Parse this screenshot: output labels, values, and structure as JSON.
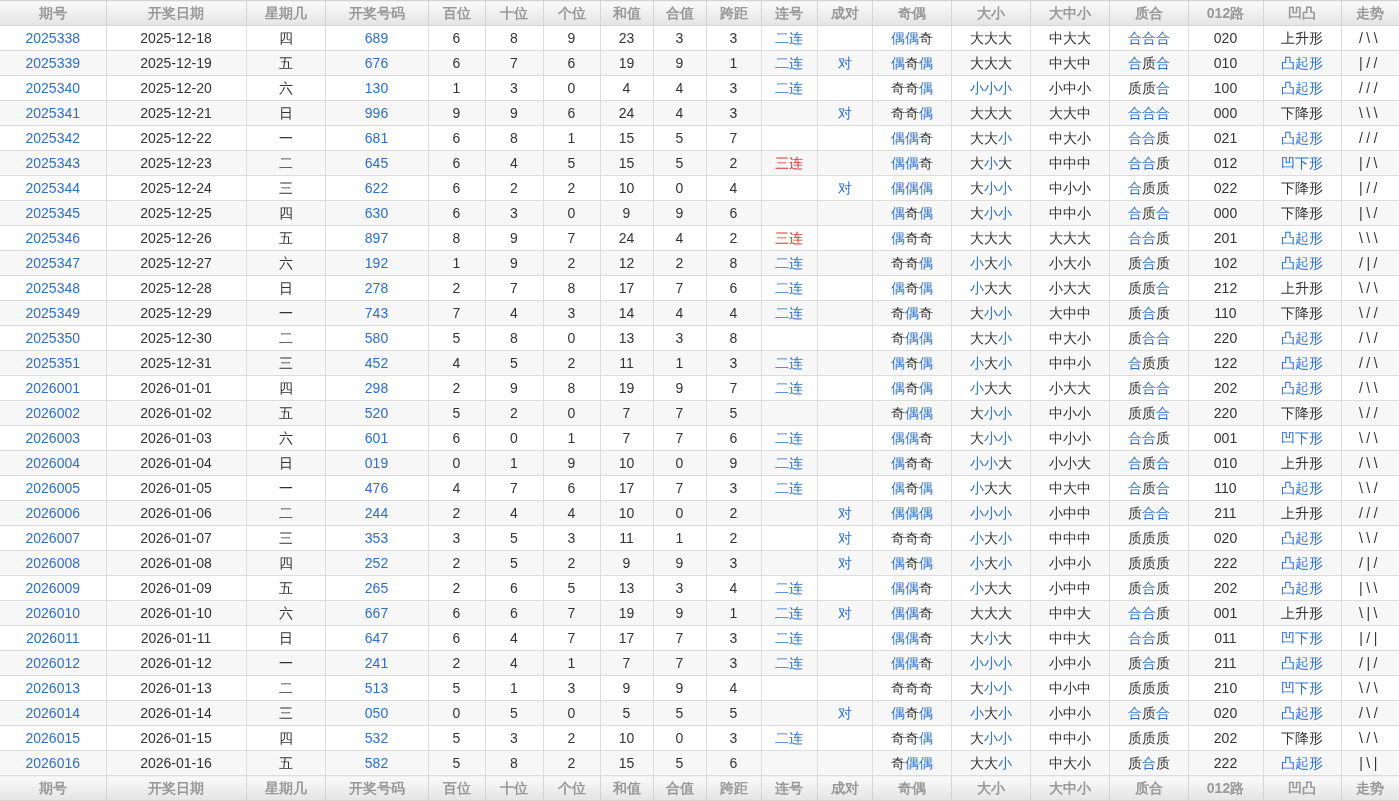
{
  "columns": [
    "期号",
    "开奖日期",
    "星期几",
    "开奖号码",
    "百位",
    "十位",
    "个位",
    "和值",
    "合值",
    "跨距",
    "连号",
    "成对",
    "奇偶",
    "大小",
    "大中小",
    "质合",
    "012路",
    "凹凸",
    "走势"
  ],
  "rows": [
    {
      "issue": "2025338",
      "date": "2025-12-18",
      "weekday": "四",
      "number": "689",
      "digits": [
        "6",
        "8",
        "9"
      ],
      "sum": "23",
      "tail": "3",
      "span": "3",
      "consec": {
        "text": "二连",
        "emphasis": false
      },
      "parity": {
        "text": "偶偶奇",
        "hl": [
          true,
          true,
          false
        ]
      },
      "size": {
        "text": "大大大",
        "hl": [
          false,
          false,
          false
        ]
      },
      "size3": "中大大",
      "prime": {
        "text": "合合合",
        "hl": [
          true,
          true,
          true
        ]
      },
      "route": "020",
      "shape": {
        "text": "上升形",
        "hl": false
      },
      "trend": "/\\\\"
    },
    {
      "issue": "2025339",
      "date": "2025-12-19",
      "weekday": "五",
      "number": "676",
      "digits": [
        "6",
        "7",
        "6"
      ],
      "sum": "19",
      "tail": "9",
      "span": "1",
      "consec": {
        "text": "二连",
        "emphasis": false
      },
      "pair": "对",
      "parity": {
        "text": "偶奇偶",
        "hl": [
          true,
          false,
          true
        ]
      },
      "size": {
        "text": "大大大",
        "hl": [
          false,
          false,
          false
        ]
      },
      "size3": "中大中",
      "prime": {
        "text": "合质合",
        "hl": [
          true,
          false,
          true
        ]
      },
      "route": "010",
      "shape": {
        "text": "凸起形",
        "hl": true
      },
      "trend": "|//"
    },
    {
      "issue": "2025340",
      "date": "2025-12-20",
      "weekday": "六",
      "number": "130",
      "digits": [
        "1",
        "3",
        "0"
      ],
      "sum": "4",
      "tail": "4",
      "span": "3",
      "consec": {
        "text": "二连",
        "emphasis": false
      },
      "parity": {
        "text": "奇奇偶",
        "hl": [
          false,
          false,
          true
        ]
      },
      "size": {
        "text": "小小小",
        "hl": [
          true,
          true,
          true
        ]
      },
      "size3": "小中小",
      "prime": {
        "text": "质质合",
        "hl": [
          false,
          false,
          true
        ]
      },
      "route": "100",
      "shape": {
        "text": "凸起形",
        "hl": true
      },
      "trend": "///"
    },
    {
      "issue": "2025341",
      "date": "2025-12-21",
      "weekday": "日",
      "number": "996",
      "digits": [
        "9",
        "9",
        "6"
      ],
      "sum": "24",
      "tail": "4",
      "span": "3",
      "pair": "对",
      "parity": {
        "text": "奇奇偶",
        "hl": [
          false,
          false,
          true
        ]
      },
      "size": {
        "text": "大大大",
        "hl": [
          false,
          false,
          false
        ]
      },
      "size3": "大大中",
      "prime": {
        "text": "合合合",
        "hl": [
          true,
          true,
          true
        ]
      },
      "route": "000",
      "shape": {
        "text": "下降形",
        "hl": false
      },
      "trend": "\\\\\\"
    },
    {
      "issue": "2025342",
      "date": "2025-12-22",
      "weekday": "一",
      "number": "681",
      "digits": [
        "6",
        "8",
        "1"
      ],
      "sum": "15",
      "tail": "5",
      "span": "7",
      "parity": {
        "text": "偶偶奇",
        "hl": [
          true,
          true,
          false
        ]
      },
      "size": {
        "text": "大大小",
        "hl": [
          false,
          false,
          true
        ]
      },
      "size3": "中大小",
      "prime": {
        "text": "合合质",
        "hl": [
          true,
          true,
          false
        ]
      },
      "route": "021",
      "shape": {
        "text": "凸起形",
        "hl": true
      },
      "trend": "///"
    },
    {
      "issue": "2025343",
      "date": "2025-12-23",
      "weekday": "二",
      "number": "645",
      "digits": [
        "6",
        "4",
        "5"
      ],
      "sum": "15",
      "tail": "5",
      "span": "2",
      "consec": {
        "text": "三连",
        "emphasis": true
      },
      "parity": {
        "text": "偶偶奇",
        "hl": [
          true,
          true,
          false
        ]
      },
      "size": {
        "text": "大小大",
        "hl": [
          false,
          true,
          false
        ]
      },
      "size3": "中中中",
      "prime": {
        "text": "合合质",
        "hl": [
          true,
          true,
          false
        ]
      },
      "route": "012",
      "shape": {
        "text": "凹下形",
        "hl": true
      },
      "trend": "|/\\"
    },
    {
      "issue": "2025344",
      "date": "2025-12-24",
      "weekday": "三",
      "number": "622",
      "digits": [
        "6",
        "2",
        "2"
      ],
      "sum": "10",
      "tail": "0",
      "span": "4",
      "pair": "对",
      "parity": {
        "text": "偶偶偶",
        "hl": [
          true,
          true,
          true
        ]
      },
      "size": {
        "text": "大小小",
        "hl": [
          false,
          true,
          true
        ]
      },
      "size3": "中小小",
      "prime": {
        "text": "合质质",
        "hl": [
          true,
          false,
          false
        ]
      },
      "route": "022",
      "shape": {
        "text": "下降形",
        "hl": false
      },
      "trend": "|//"
    },
    {
      "issue": "2025345",
      "date": "2025-12-25",
      "weekday": "四",
      "number": "630",
      "digits": [
        "6",
        "3",
        "0"
      ],
      "sum": "9",
      "tail": "9",
      "span": "6",
      "parity": {
        "text": "偶奇偶",
        "hl": [
          true,
          false,
          true
        ]
      },
      "size": {
        "text": "大小小",
        "hl": [
          false,
          true,
          true
        ]
      },
      "size3": "中中小",
      "prime": {
        "text": "合质合",
        "hl": [
          true,
          false,
          true
        ]
      },
      "route": "000",
      "shape": {
        "text": "下降形",
        "hl": false
      },
      "trend": "|\\/"
    },
    {
      "issue": "2025346",
      "date": "2025-12-26",
      "weekday": "五",
      "number": "897",
      "digits": [
        "8",
        "9",
        "7"
      ],
      "sum": "24",
      "tail": "4",
      "span": "2",
      "consec": {
        "text": "三连",
        "emphasis": true
      },
      "parity": {
        "text": "偶奇奇",
        "hl": [
          true,
          false,
          false
        ]
      },
      "size": {
        "text": "大大大",
        "hl": [
          false,
          false,
          false
        ]
      },
      "size3": "大大大",
      "prime": {
        "text": "合合质",
        "hl": [
          true,
          true,
          false
        ]
      },
      "route": "201",
      "shape": {
        "text": "凸起形",
        "hl": true
      },
      "trend": "\\\\\\"
    },
    {
      "issue": "2025347",
      "date": "2025-12-27",
      "weekday": "六",
      "number": "192",
      "digits": [
        "1",
        "9",
        "2"
      ],
      "sum": "12",
      "tail": "2",
      "span": "8",
      "consec": {
        "text": "二连",
        "emphasis": false
      },
      "parity": {
        "text": "奇奇偶",
        "hl": [
          false,
          false,
          true
        ]
      },
      "size": {
        "text": "小大小",
        "hl": [
          true,
          false,
          true
        ]
      },
      "size3": "小大小",
      "prime": {
        "text": "质合质",
        "hl": [
          false,
          true,
          false
        ]
      },
      "route": "102",
      "shape": {
        "text": "凸起形",
        "hl": true
      },
      "trend": "/|/"
    },
    {
      "issue": "2025348",
      "date": "2025-12-28",
      "weekday": "日",
      "number": "278",
      "digits": [
        "2",
        "7",
        "8"
      ],
      "sum": "17",
      "tail": "7",
      "span": "6",
      "consec": {
        "text": "二连",
        "emphasis": false
      },
      "parity": {
        "text": "偶奇偶",
        "hl": [
          true,
          false,
          true
        ]
      },
      "size": {
        "text": "小大大",
        "hl": [
          true,
          false,
          false
        ]
      },
      "size3": "小大大",
      "prime": {
        "text": "质质合",
        "hl": [
          false,
          false,
          true
        ]
      },
      "route": "212",
      "shape": {
        "text": "上升形",
        "hl": false
      },
      "trend": "\\/\\"
    },
    {
      "issue": "2025349",
      "date": "2025-12-29",
      "weekday": "一",
      "number": "743",
      "digits": [
        "7",
        "4",
        "3"
      ],
      "sum": "14",
      "tail": "4",
      "span": "4",
      "consec": {
        "text": "二连",
        "emphasis": false
      },
      "parity": {
        "text": "奇偶奇",
        "hl": [
          false,
          true,
          false
        ]
      },
      "size": {
        "text": "大小小",
        "hl": [
          false,
          true,
          true
        ]
      },
      "size3": "大中中",
      "prime": {
        "text": "质合质",
        "hl": [
          false,
          true,
          false
        ]
      },
      "route": "110",
      "shape": {
        "text": "下降形",
        "hl": false
      },
      "trend": "\\//"
    },
    {
      "issue": "2025350",
      "date": "2025-12-30",
      "weekday": "二",
      "number": "580",
      "digits": [
        "5",
        "8",
        "0"
      ],
      "sum": "13",
      "tail": "3",
      "span": "8",
      "parity": {
        "text": "奇偶偶",
        "hl": [
          false,
          true,
          true
        ]
      },
      "size": {
        "text": "大大小",
        "hl": [
          false,
          false,
          true
        ]
      },
      "size3": "中大小",
      "prime": {
        "text": "质合合",
        "hl": [
          false,
          true,
          true
        ]
      },
      "route": "220",
      "shape": {
        "text": "凸起形",
        "hl": true
      },
      "trend": "/\\/"
    },
    {
      "issue": "2025351",
      "date": "2025-12-31",
      "weekday": "三",
      "number": "452",
      "digits": [
        "4",
        "5",
        "2"
      ],
      "sum": "11",
      "tail": "1",
      "span": "3",
      "consec": {
        "text": "二连",
        "emphasis": false
      },
      "parity": {
        "text": "偶奇偶",
        "hl": [
          true,
          false,
          true
        ]
      },
      "size": {
        "text": "小大小",
        "hl": [
          true,
          false,
          true
        ]
      },
      "size3": "中中小",
      "prime": {
        "text": "合质质",
        "hl": [
          true,
          false,
          false
        ]
      },
      "route": "122",
      "shape": {
        "text": "凸起形",
        "hl": true
      },
      "trend": "//\\"
    },
    {
      "issue": "2026001",
      "date": "2026-01-01",
      "weekday": "四",
      "number": "298",
      "digits": [
        "2",
        "9",
        "8"
      ],
      "sum": "19",
      "tail": "9",
      "span": "7",
      "consec": {
        "text": "二连",
        "emphasis": false
      },
      "parity": {
        "text": "偶奇偶",
        "hl": [
          true,
          false,
          true
        ]
      },
      "size": {
        "text": "小大大",
        "hl": [
          true,
          false,
          false
        ]
      },
      "size3": "小大大",
      "prime": {
        "text": "质合合",
        "hl": [
          false,
          true,
          true
        ]
      },
      "route": "202",
      "shape": {
        "text": "凸起形",
        "hl": true
      },
      "trend": "/\\\\"
    },
    {
      "issue": "2026002",
      "date": "2026-01-02",
      "weekday": "五",
      "number": "520",
      "digits": [
        "5",
        "2",
        "0"
      ],
      "sum": "7",
      "tail": "7",
      "span": "5",
      "parity": {
        "text": "奇偶偶",
        "hl": [
          false,
          true,
          true
        ]
      },
      "size": {
        "text": "大小小",
        "hl": [
          false,
          true,
          true
        ]
      },
      "size3": "中小小",
      "prime": {
        "text": "质质合",
        "hl": [
          false,
          false,
          true
        ]
      },
      "route": "220",
      "shape": {
        "text": "下降形",
        "hl": false
      },
      "trend": "\\//"
    },
    {
      "issue": "2026003",
      "date": "2026-01-03",
      "weekday": "六",
      "number": "601",
      "digits": [
        "6",
        "0",
        "1"
      ],
      "sum": "7",
      "tail": "7",
      "span": "6",
      "consec": {
        "text": "二连",
        "emphasis": false
      },
      "parity": {
        "text": "偶偶奇",
        "hl": [
          true,
          true,
          false
        ]
      },
      "size": {
        "text": "大小小",
        "hl": [
          false,
          true,
          true
        ]
      },
      "size3": "中小小",
      "prime": {
        "text": "合合质",
        "hl": [
          true,
          true,
          false
        ]
      },
      "route": "001",
      "shape": {
        "text": "凹下形",
        "hl": true
      },
      "trend": "\\/\\"
    },
    {
      "issue": "2026004",
      "date": "2026-01-04",
      "weekday": "日",
      "number": "019",
      "digits": [
        "0",
        "1",
        "9"
      ],
      "sum": "10",
      "tail": "0",
      "span": "9",
      "consec": {
        "text": "二连",
        "emphasis": false
      },
      "parity": {
        "text": "偶奇奇",
        "hl": [
          true,
          false,
          false
        ]
      },
      "size": {
        "text": "小小大",
        "hl": [
          true,
          true,
          false
        ]
      },
      "size3": "小小大",
      "prime": {
        "text": "合质合",
        "hl": [
          true,
          false,
          true
        ]
      },
      "route": "010",
      "shape": {
        "text": "上升形",
        "hl": false
      },
      "trend": "/\\\\"
    },
    {
      "issue": "2026005",
      "date": "2026-01-05",
      "weekday": "一",
      "number": "476",
      "digits": [
        "4",
        "7",
        "6"
      ],
      "sum": "17",
      "tail": "7",
      "span": "3",
      "consec": {
        "text": "二连",
        "emphasis": false
      },
      "parity": {
        "text": "偶奇偶",
        "hl": [
          true,
          false,
          true
        ]
      },
      "size": {
        "text": "小大大",
        "hl": [
          true,
          false,
          false
        ]
      },
      "size3": "中大中",
      "prime": {
        "text": "合质合",
        "hl": [
          true,
          false,
          true
        ]
      },
      "route": "110",
      "shape": {
        "text": "凸起形",
        "hl": true
      },
      "trend": "\\\\/"
    },
    {
      "issue": "2026006",
      "date": "2026-01-06",
      "weekday": "二",
      "number": "244",
      "digits": [
        "2",
        "4",
        "4"
      ],
      "sum": "10",
      "tail": "0",
      "span": "2",
      "pair": "对",
      "parity": {
        "text": "偶偶偶",
        "hl": [
          true,
          true,
          true
        ]
      },
      "size": {
        "text": "小小小",
        "hl": [
          true,
          true,
          true
        ]
      },
      "size3": "小中中",
      "prime": {
        "text": "质合合",
        "hl": [
          false,
          true,
          true
        ]
      },
      "route": "211",
      "shape": {
        "text": "上升形",
        "hl": false
      },
      "trend": "///"
    },
    {
      "issue": "2026007",
      "date": "2026-01-07",
      "weekday": "三",
      "number": "353",
      "digits": [
        "3",
        "5",
        "3"
      ],
      "sum": "11",
      "tail": "1",
      "span": "2",
      "pair": "对",
      "parity": {
        "text": "奇奇奇",
        "hl": [
          false,
          false,
          false
        ]
      },
      "size": {
        "text": "小大小",
        "hl": [
          true,
          false,
          true
        ]
      },
      "size3": "中中中",
      "prime": {
        "text": "质质质",
        "hl": [
          false,
          false,
          false
        ]
      },
      "route": "020",
      "shape": {
        "text": "凸起形",
        "hl": true
      },
      "trend": "\\\\/"
    },
    {
      "issue": "2026008",
      "date": "2026-01-08",
      "weekday": "四",
      "number": "252",
      "digits": [
        "2",
        "5",
        "2"
      ],
      "sum": "9",
      "tail": "9",
      "span": "3",
      "pair": "对",
      "parity": {
        "text": "偶奇偶",
        "hl": [
          true,
          false,
          true
        ]
      },
      "size": {
        "text": "小大小",
        "hl": [
          true,
          false,
          true
        ]
      },
      "size3": "小中小",
      "prime": {
        "text": "质质质",
        "hl": [
          false,
          false,
          false
        ]
      },
      "route": "222",
      "shape": {
        "text": "凸起形",
        "hl": true
      },
      "trend": "/|/"
    },
    {
      "issue": "2026009",
      "date": "2026-01-09",
      "weekday": "五",
      "number": "265",
      "digits": [
        "2",
        "6",
        "5"
      ],
      "sum": "13",
      "tail": "3",
      "span": "4",
      "consec": {
        "text": "二连",
        "emphasis": false
      },
      "parity": {
        "text": "偶偶奇",
        "hl": [
          true,
          true,
          false
        ]
      },
      "size": {
        "text": "小大大",
        "hl": [
          true,
          false,
          false
        ]
      },
      "size3": "小中中",
      "prime": {
        "text": "质合质",
        "hl": [
          false,
          true,
          false
        ]
      },
      "route": "202",
      "shape": {
        "text": "凸起形",
        "hl": true
      },
      "trend": "|\\\\"
    },
    {
      "issue": "2026010",
      "date": "2026-01-10",
      "weekday": "六",
      "number": "667",
      "digits": [
        "6",
        "6",
        "7"
      ],
      "sum": "19",
      "tail": "9",
      "span": "1",
      "consec": {
        "text": "二连",
        "emphasis": false
      },
      "pair": "对",
      "parity": {
        "text": "偶偶奇",
        "hl": [
          true,
          true,
          false
        ]
      },
      "size": {
        "text": "大大大",
        "hl": [
          false,
          false,
          false
        ]
      },
      "size3": "中中大",
      "prime": {
        "text": "合合质",
        "hl": [
          true,
          true,
          false
        ]
      },
      "route": "001",
      "shape": {
        "text": "上升形",
        "hl": false
      },
      "trend": "\\|\\"
    },
    {
      "issue": "2026011",
      "date": "2026-01-11",
      "weekday": "日",
      "number": "647",
      "digits": [
        "6",
        "4",
        "7"
      ],
      "sum": "17",
      "tail": "7",
      "span": "3",
      "consec": {
        "text": "二连",
        "emphasis": false
      },
      "parity": {
        "text": "偶偶奇",
        "hl": [
          true,
          true,
          false
        ]
      },
      "size": {
        "text": "大小大",
        "hl": [
          false,
          true,
          false
        ]
      },
      "size3": "中中大",
      "prime": {
        "text": "合合质",
        "hl": [
          true,
          true,
          false
        ]
      },
      "route": "011",
      "shape": {
        "text": "凹下形",
        "hl": true
      },
      "trend": "|/|"
    },
    {
      "issue": "2026012",
      "date": "2026-01-12",
      "weekday": "一",
      "number": "241",
      "digits": [
        "2",
        "4",
        "1"
      ],
      "sum": "7",
      "tail": "7",
      "span": "3",
      "consec": {
        "text": "二连",
        "emphasis": false
      },
      "parity": {
        "text": "偶偶奇",
        "hl": [
          true,
          true,
          false
        ]
      },
      "size": {
        "text": "小小小",
        "hl": [
          true,
          true,
          true
        ]
      },
      "size3": "小中小",
      "prime": {
        "text": "质合质",
        "hl": [
          false,
          true,
          false
        ]
      },
      "route": "211",
      "shape": {
        "text": "凸起形",
        "hl": true
      },
      "trend": "/|/"
    },
    {
      "issue": "2026013",
      "date": "2026-01-13",
      "weekday": "二",
      "number": "513",
      "digits": [
        "5",
        "1",
        "3"
      ],
      "sum": "9",
      "tail": "9",
      "span": "4",
      "parity": {
        "text": "奇奇奇",
        "hl": [
          false,
          false,
          false
        ]
      },
      "size": {
        "text": "大小小",
        "hl": [
          false,
          true,
          true
        ]
      },
      "size3": "中小中",
      "prime": {
        "text": "质质质",
        "hl": [
          false,
          false,
          false
        ]
      },
      "route": "210",
      "shape": {
        "text": "凹下形",
        "hl": true
      },
      "trend": "\\/\\"
    },
    {
      "issue": "2026014",
      "date": "2026-01-14",
      "weekday": "三",
      "number": "050",
      "digits": [
        "0",
        "5",
        "0"
      ],
      "sum": "5",
      "tail": "5",
      "span": "5",
      "pair": "对",
      "parity": {
        "text": "偶奇偶",
        "hl": [
          true,
          false,
          true
        ]
      },
      "size": {
        "text": "小大小",
        "hl": [
          true,
          false,
          true
        ]
      },
      "size3": "小中小",
      "prime": {
        "text": "合质合",
        "hl": [
          true,
          false,
          true
        ]
      },
      "route": "020",
      "shape": {
        "text": "凸起形",
        "hl": true
      },
      "trend": "/\\/"
    },
    {
      "issue": "2026015",
      "date": "2026-01-15",
      "weekday": "四",
      "number": "532",
      "digits": [
        "5",
        "3",
        "2"
      ],
      "sum": "10",
      "tail": "0",
      "span": "3",
      "consec": {
        "text": "二连",
        "emphasis": false
      },
      "parity": {
        "text": "奇奇偶",
        "hl": [
          false,
          false,
          true
        ]
      },
      "size": {
        "text": "大小小",
        "hl": [
          false,
          true,
          true
        ]
      },
      "size3": "中中小",
      "prime": {
        "text": "质质质",
        "hl": [
          false,
          false,
          false
        ]
      },
      "route": "202",
      "shape": {
        "text": "下降形",
        "hl": false
      },
      "trend": "\\/\\"
    },
    {
      "issue": "2026016",
      "date": "2026-01-16",
      "weekday": "五",
      "number": "582",
      "digits": [
        "5",
        "8",
        "2"
      ],
      "sum": "15",
      "tail": "5",
      "span": "6",
      "parity": {
        "text": "奇偶偶",
        "hl": [
          false,
          true,
          true
        ]
      },
      "size": {
        "text": "大大小",
        "hl": [
          false,
          false,
          true
        ]
      },
      "size3": "中大小",
      "prime": {
        "text": "质合质",
        "hl": [
          false,
          true,
          false
        ]
      },
      "route": "222",
      "shape": {
        "text": "凸起形",
        "hl": true
      },
      "trend": "|\\|"
    }
  ],
  "footer_columns": [
    "期号",
    "开奖日期",
    "星期几",
    "开奖号码",
    "百位",
    "十位",
    "个位",
    "和值",
    "合值",
    "跨距",
    "连号",
    "成对",
    "奇偶",
    "大小",
    "大中小",
    "质合",
    "012路",
    "凹凸",
    "走势"
  ]
}
